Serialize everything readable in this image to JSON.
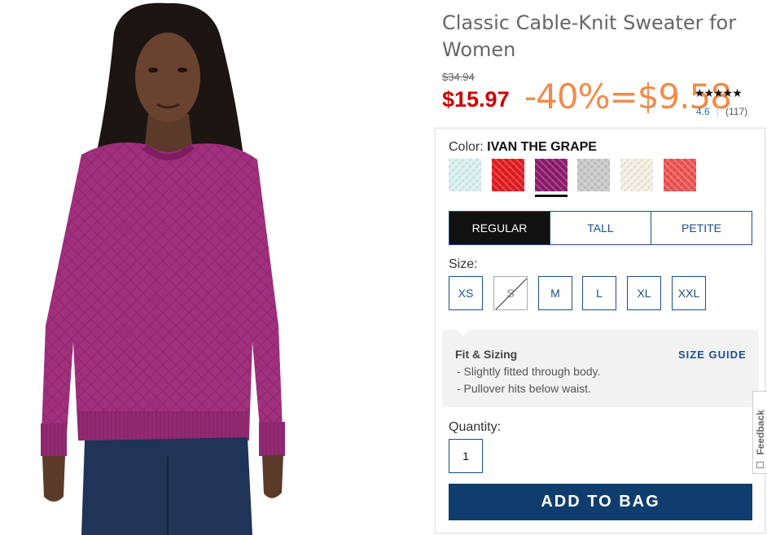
{
  "product": {
    "title": "Classic Cable-Knit Sweater for Women",
    "original_price": "$34.94",
    "sale_price": "$15.97",
    "discount_overlay": "-40%=$9.58",
    "stars": "★★★★★",
    "rating": "4.6",
    "review_count": "(117)"
  },
  "color": {
    "label": "Color:",
    "selected_name": "IVAN THE GRAPE",
    "swatches": [
      {
        "name": "light-aqua",
        "hex": "#d9f2f1"
      },
      {
        "name": "red",
        "hex": "#e41b1f"
      },
      {
        "name": "purple",
        "hex": "#8e1a6e"
      },
      {
        "name": "light-gray",
        "hex": "#c9c9c9"
      },
      {
        "name": "cream",
        "hex": "#f4f1e4"
      },
      {
        "name": "coral",
        "hex": "#ec5552"
      }
    ],
    "selected_index": 2
  },
  "fit_tabs": [
    "REGULAR",
    "TALL",
    "PETITE"
  ],
  "fit_tab_active": "REGULAR",
  "size": {
    "label": "Size:",
    "options": [
      "XS",
      "S",
      "M",
      "L",
      "XL",
      "XXL"
    ],
    "unavailable": [
      "S"
    ]
  },
  "fit_sizing": {
    "title": "Fit & Sizing",
    "guide_link": "SIZE GUIDE",
    "lines": [
      "- Slightly fitted through body.",
      "- Pullover hits below waist."
    ]
  },
  "quantity": {
    "label": "Quantity:",
    "value": "1"
  },
  "add_to_bag": "ADD TO BAG",
  "feedback": "Feedback",
  "colors": {
    "sale_red": "#cc0000",
    "discount_orange": "#f28b49",
    "brand_navy": "#0f3d6e",
    "link_blue": "#1b4f8a",
    "sweater": "#a0307d"
  }
}
